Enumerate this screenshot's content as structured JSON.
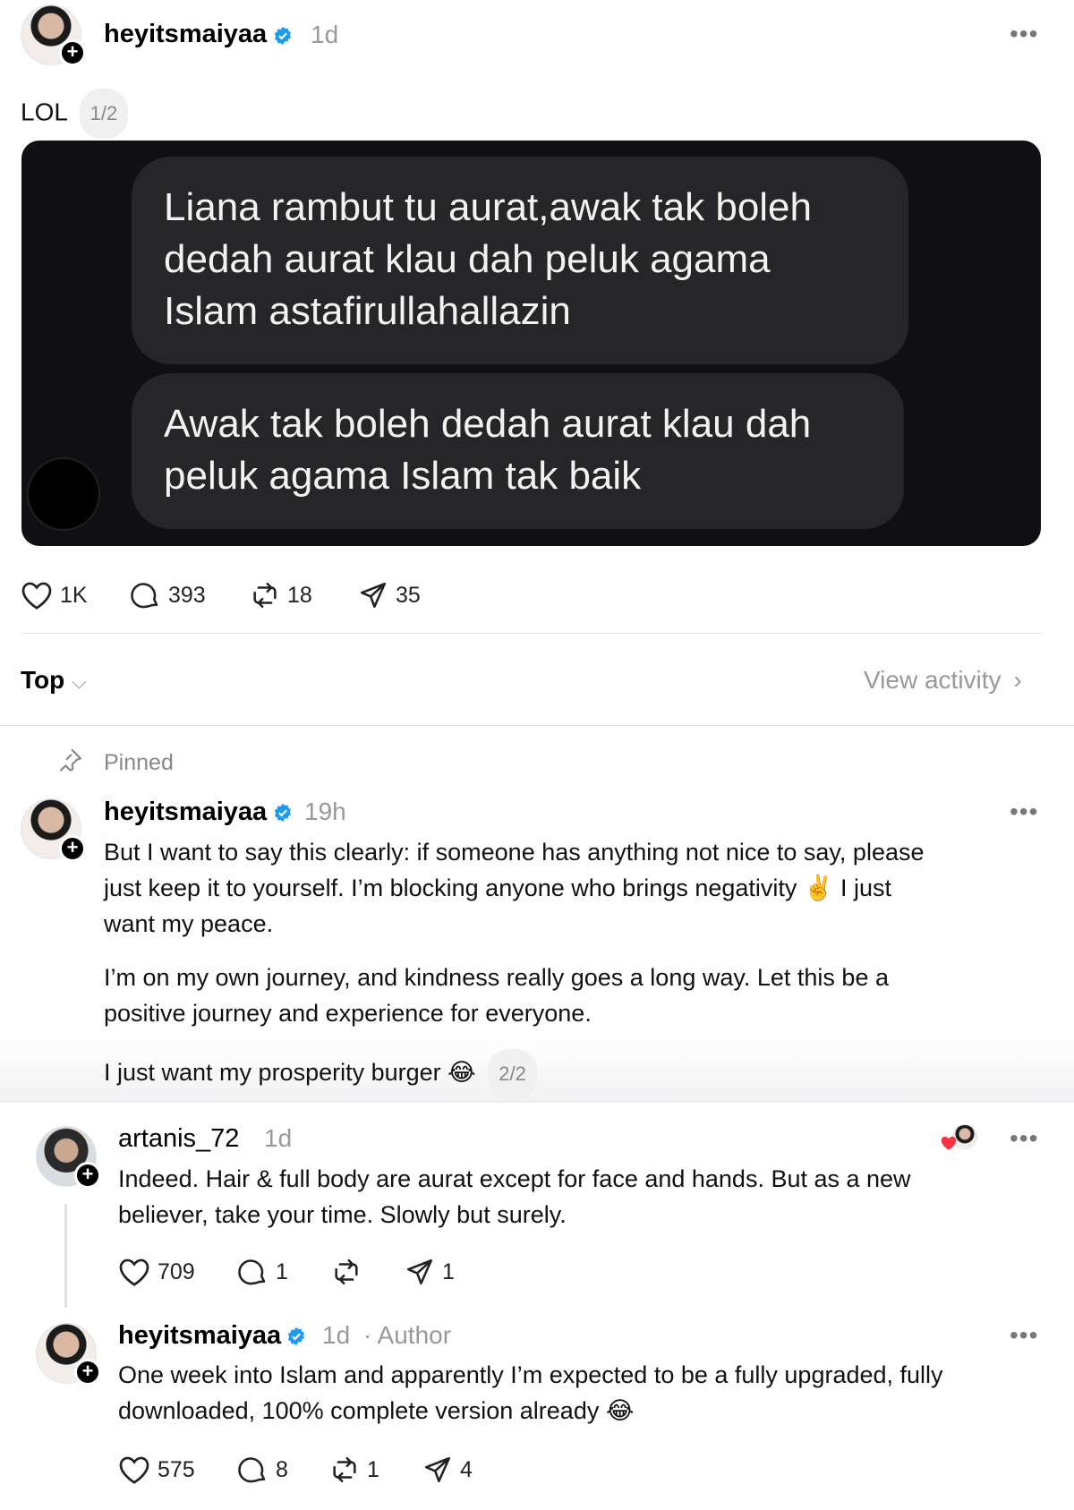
{
  "post": {
    "username": "heyitsmaiyaa",
    "time": "1d",
    "text": "LOL",
    "page": "1/2",
    "image": {
      "bubble1": [
        "Liana rambut tu aurat,awak tak boleh",
        "dedah aurat klau dah peluk agama",
        "Islam astafirullahallazin"
      ],
      "bubble2": [
        "Awak tak boleh dedah aurat klau dah",
        "peluk agama Islam tak baik"
      ]
    },
    "likes": "1K",
    "comments": "393",
    "reposts": "18",
    "shares": "35"
  },
  "sort": {
    "label": "Top",
    "activity": "View activity"
  },
  "pinned": {
    "label": "Pinned",
    "username": "heyitsmaiyaa",
    "time": "19h",
    "lines": [
      "But I want to say this clearly: if someone has anything not nice to say, please",
      "just keep it to yourself. I’m blocking anyone who brings negativity ✌️ I just",
      "want my peace.",
      "I’m on my own journey, and kindness really goes a long way. Let this be a",
      "positive journey and experience for everyone.",
      "I just want my prosperity burger 😂"
    ],
    "page": "2/2"
  },
  "reply1": {
    "username": "artanis_72",
    "time": "1d",
    "lines": [
      "Indeed. Hair & full body are aurat except for face and hands. But as a new",
      "believer, take your time. Slowly but surely."
    ],
    "likes": "709",
    "comments": "1",
    "reposts": "",
    "shares": "1"
  },
  "reply2": {
    "username": "heyitsmaiyaa",
    "time": "1d",
    "author": "· Author",
    "lines": [
      "One week into Islam and apparently I’m expected to be a fully upgraded, fully",
      "downloaded, 100% complete version already 😂"
    ],
    "likes": "575",
    "comments": "8",
    "reposts": "1",
    "shares": "4"
  },
  "colors": {
    "verified": "#1d9bf0",
    "liked_heart": "#ff3040"
  }
}
